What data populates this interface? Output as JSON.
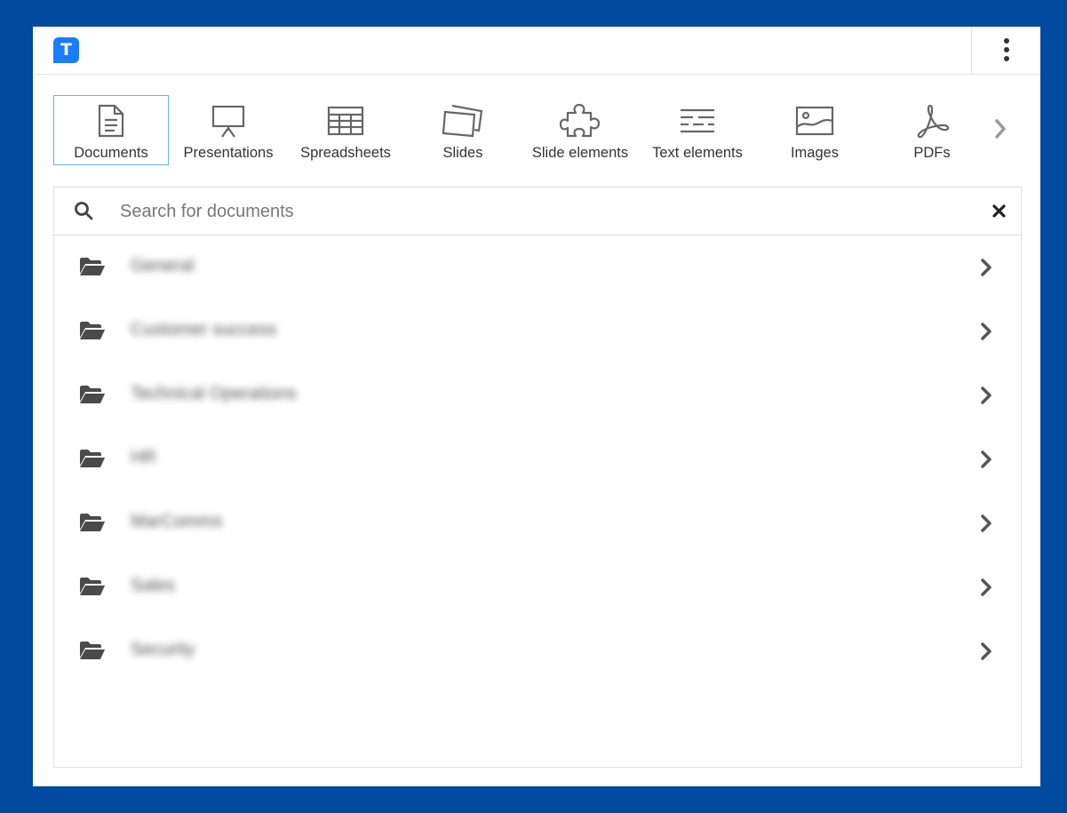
{
  "app": {
    "logo_letter": "T",
    "logo_color": "#1a7cff",
    "background_color": "#004a9f"
  },
  "menu": {
    "icon": "more-vertical-icon"
  },
  "tabs": [
    {
      "label": "Documents",
      "icon": "document-icon",
      "active": true
    },
    {
      "label": "Presentations",
      "icon": "presentation-icon",
      "active": false
    },
    {
      "label": "Spreadsheets",
      "icon": "spreadsheet-icon",
      "active": false
    },
    {
      "label": "Slides",
      "icon": "slides-icon",
      "active": false
    },
    {
      "label": "Slide elements",
      "icon": "puzzle-icon",
      "active": false
    },
    {
      "label": "Text elements",
      "icon": "text-lines-icon",
      "active": false
    },
    {
      "label": "Images",
      "icon": "image-icon",
      "active": false
    },
    {
      "label": "PDFs",
      "icon": "pdf-icon",
      "active": false
    }
  ],
  "search": {
    "placeholder": "Search for documents",
    "value": ""
  },
  "folders": [
    {
      "name": "General"
    },
    {
      "name": "Customer success"
    },
    {
      "name": "Technical Operations"
    },
    {
      "name": "HR"
    },
    {
      "name": "MarComms"
    },
    {
      "name": "Sales"
    },
    {
      "name": "Security"
    }
  ]
}
